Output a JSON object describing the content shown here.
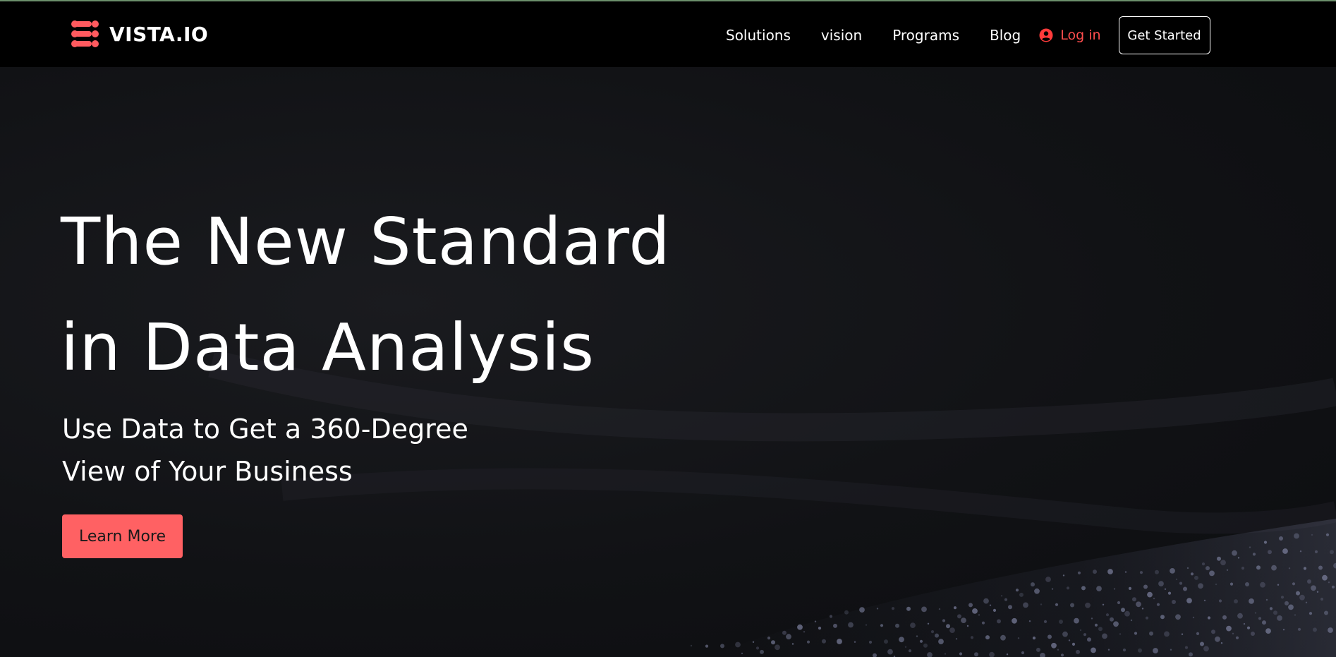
{
  "brand": {
    "name": "VISTA.IO",
    "logo_icon": "vista-logo-mark",
    "accent_color": "#ff5a5f"
  },
  "nav": {
    "items": [
      {
        "label": "Solutions"
      },
      {
        "label": "vision"
      },
      {
        "label": "Programs"
      },
      {
        "label": "Blog"
      }
    ],
    "login": {
      "label": "Log in",
      "icon": "user-circle-icon",
      "color": "#ff4d4d"
    },
    "cta_label": "Get Started"
  },
  "hero": {
    "headline": [
      "The New Standard",
      "in Data Analysis"
    ],
    "subheadline": [
      "Use Data to Get a 360-Degree",
      "View of Your Business"
    ],
    "button_label": "Learn More",
    "button_color": "#ff6163",
    "background_color": "#111215"
  }
}
